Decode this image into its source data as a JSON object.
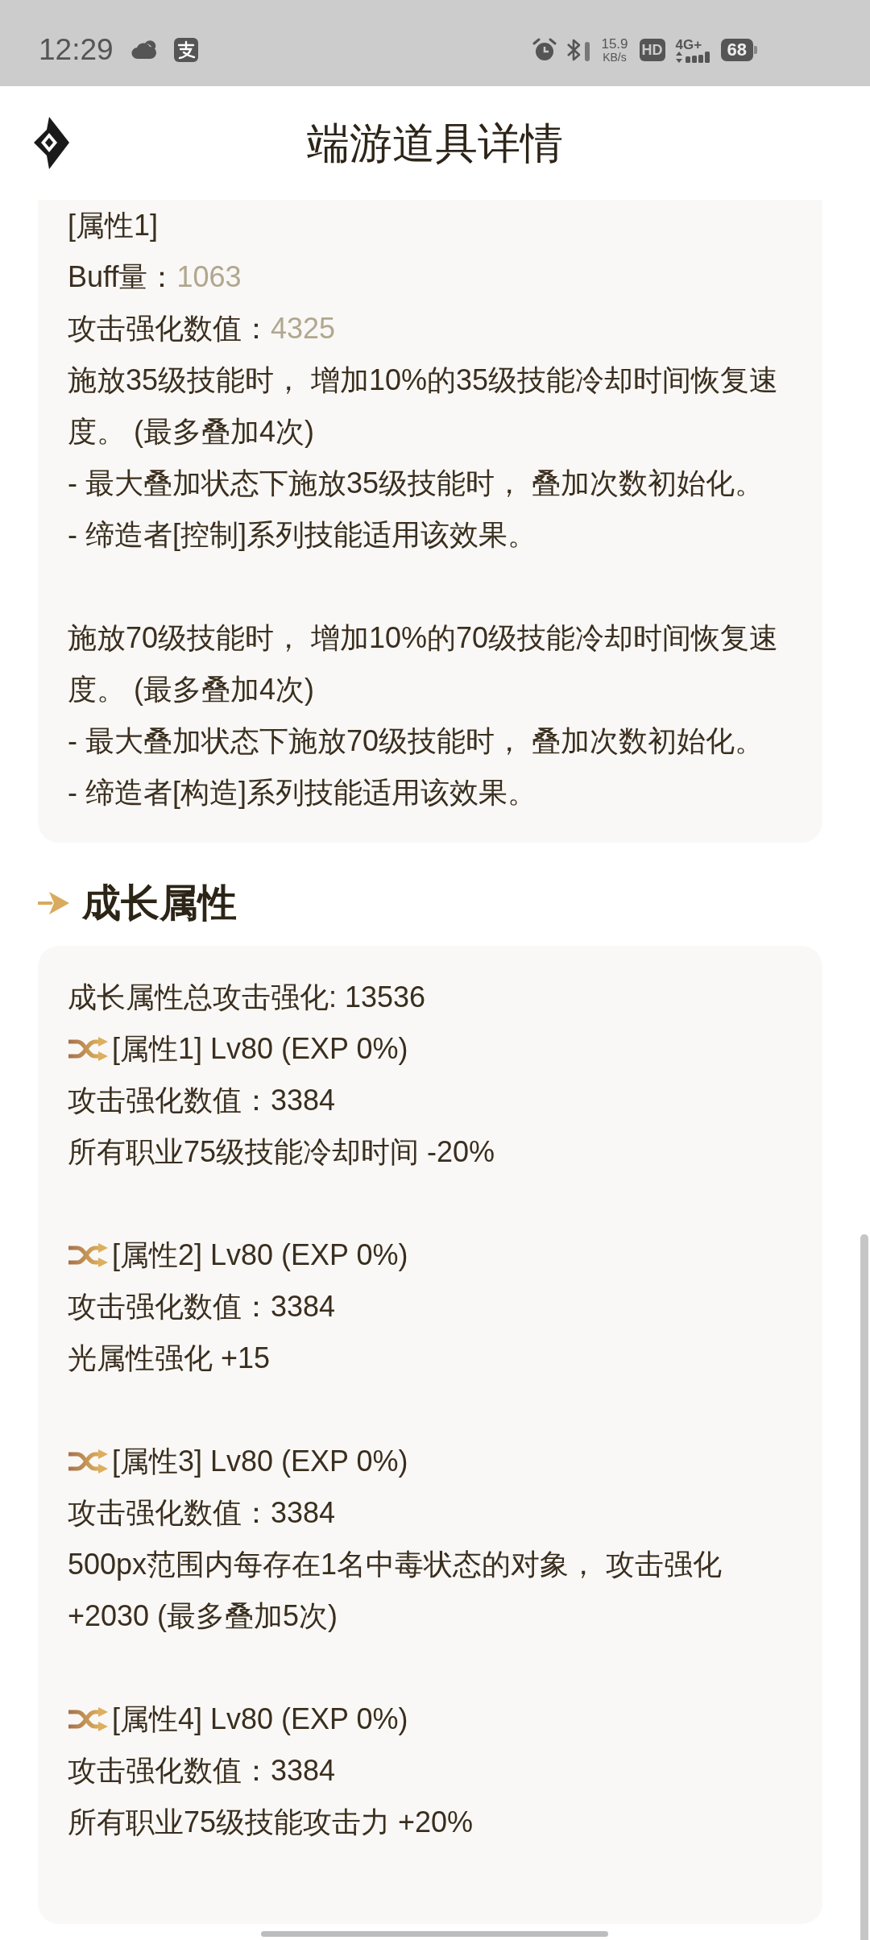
{
  "status_bar": {
    "time": "12:29",
    "net_speed": "15.9",
    "net_speed_unit": "KB/s",
    "hd_badge": "HD",
    "network_type": "4G+",
    "battery": "68"
  },
  "header": {
    "title": "端游道具详情"
  },
  "option_card": {
    "blocks": [
      {
        "lines": [
          {
            "kind": "text",
            "text": "[属性1]"
          },
          {
            "kind": "stat",
            "label": "Buff量：",
            "value": "1063"
          },
          {
            "kind": "stat",
            "label": "攻击强化数值：",
            "value": "4325"
          },
          {
            "kind": "text",
            "text": "施放35级技能时， 增加10%的35级技能冷却时间恢复速度。 (最多叠加4次)"
          },
          {
            "kind": "text",
            "text": "- 最大叠加状态下施放35级技能时， 叠加次数初始化。"
          },
          {
            "kind": "text",
            "text": "- 缔造者[控制]系列技能适用该效果。"
          }
        ]
      },
      {
        "lines": [
          {
            "kind": "text",
            "text": "施放70级技能时， 增加10%的70级技能冷却时间恢复速度。 (最多叠加4次)"
          },
          {
            "kind": "text",
            "text": "- 最大叠加状态下施放70级技能时， 叠加次数初始化。"
          },
          {
            "kind": "text",
            "text": "- 缔造者[构造]系列技能适用该效果。"
          }
        ]
      }
    ]
  },
  "growth_section": {
    "title": "成长属性",
    "summary": "成长属性总攻击强化: 13536",
    "attributes": [
      {
        "title": "[属性1] Lv80 (EXP 0%)",
        "lines": [
          "攻击强化数值：3384",
          "所有职业75级技能冷却时间 -20%"
        ]
      },
      {
        "title": "[属性2] Lv80 (EXP 0%)",
        "lines": [
          "攻击强化数值：3384",
          "光属性强化 +15"
        ]
      },
      {
        "title": "[属性3] Lv80 (EXP 0%)",
        "lines": [
          "攻击强化数值：3384",
          "500px范围内每存在1名中毒状态的对象， 攻击强化 +2030 (最多叠加5次)"
        ]
      },
      {
        "title": "[属性4] Lv80 (EXP 0%)",
        "lines": [
          "攻击强化数值：3384",
          "所有职业75级技能攻击力 +20%"
        ]
      }
    ]
  }
}
